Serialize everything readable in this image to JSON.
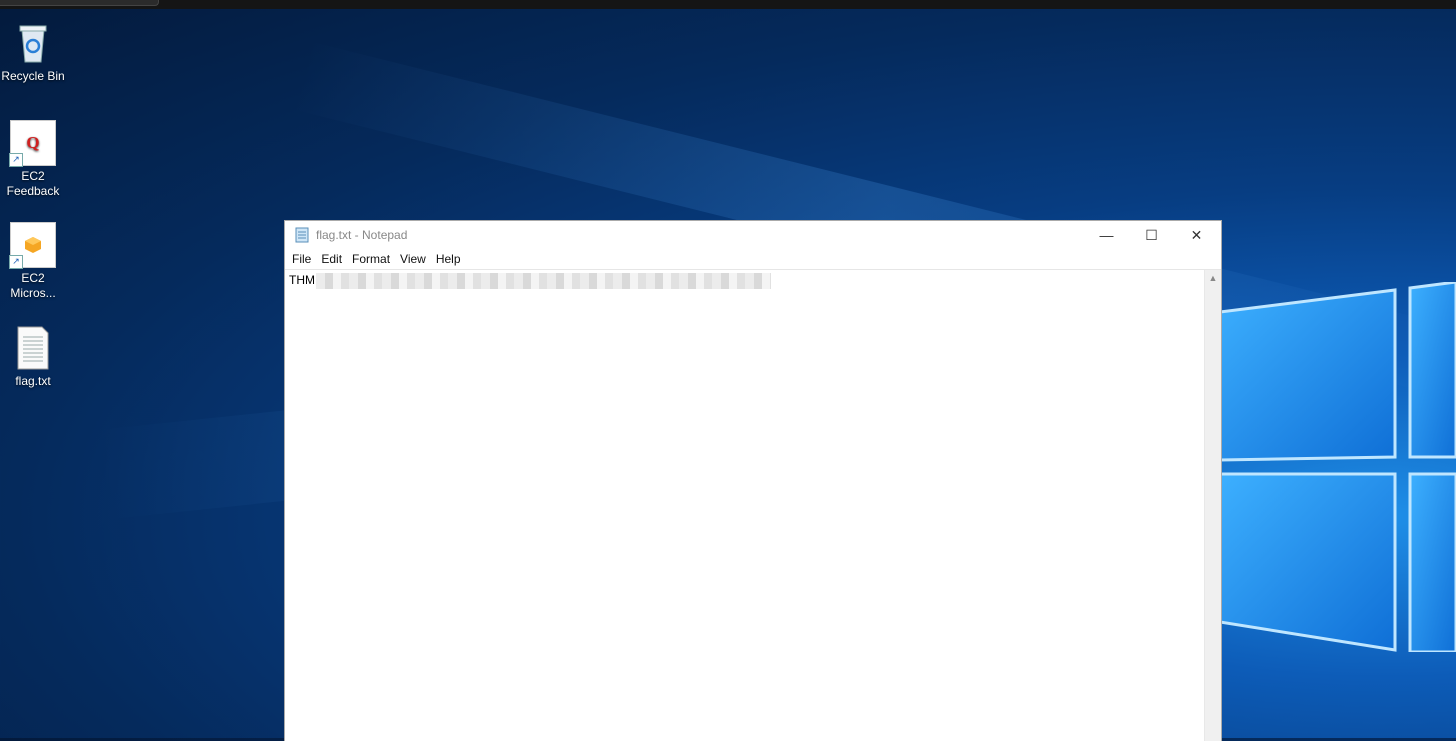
{
  "desktop": {
    "icons": [
      {
        "label": "Recycle Bin",
        "icon": "recycle-bin-icon"
      },
      {
        "label": "EC2 Feedback",
        "icon": "ec2-feedback-icon"
      },
      {
        "label": "EC2 Micros...",
        "icon": "ec2-microsoft-icon"
      },
      {
        "label": "flag.txt",
        "icon": "text-file-icon"
      }
    ]
  },
  "notepad": {
    "title": "flag.txt - Notepad",
    "menu": [
      "File",
      "Edit",
      "Format",
      "View",
      "Help"
    ],
    "content_visible": "THM",
    "controls": {
      "minimize": "—",
      "maximize": "☐",
      "close": "✕"
    }
  },
  "colors": {
    "accent": "#1e8fe8",
    "desktop_dark": "#031a3c"
  }
}
